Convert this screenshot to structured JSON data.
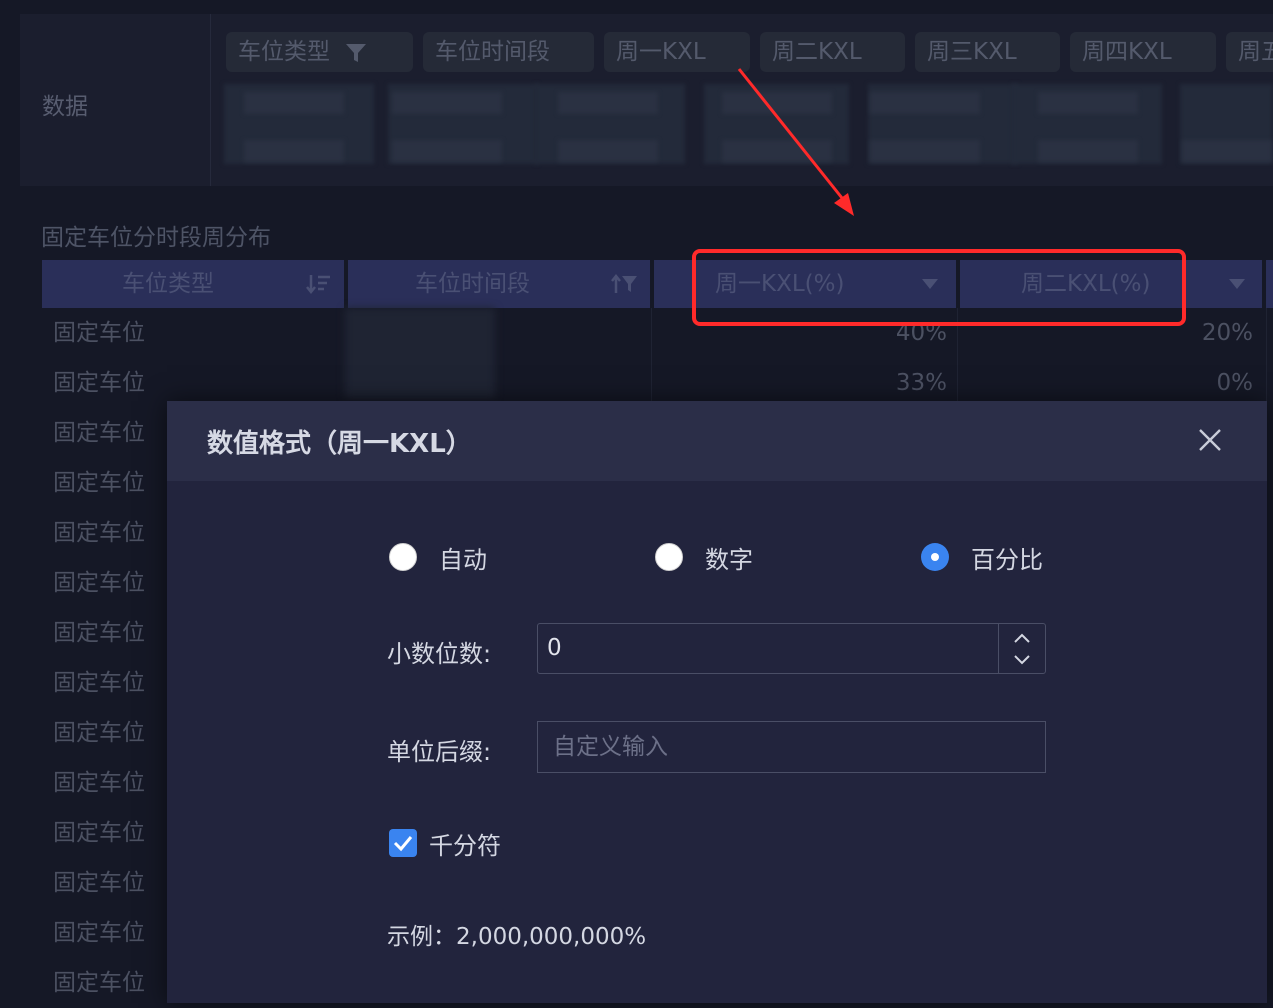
{
  "data_panel": {
    "label": "数据",
    "chips": [
      "车位类型",
      "车位时间段",
      "周一KXL",
      "周二KXL",
      "周三KXL",
      "周四KXL",
      "周五"
    ]
  },
  "report": {
    "title": "固定车位分时段周分布",
    "headers": [
      "车位类型",
      "车位时间段",
      "周一KXL(%)",
      "周二KXL(%)"
    ],
    "rows": [
      {
        "type": "固定车位",
        "mon": "40%",
        "tue": "20%"
      },
      {
        "type": "固定车位",
        "mon": "33%",
        "tue": "0%"
      },
      {
        "type": "固定车位"
      },
      {
        "type": "固定车位"
      },
      {
        "type": "固定车位"
      },
      {
        "type": "固定车位"
      },
      {
        "type": "固定车位"
      },
      {
        "type": "固定车位"
      },
      {
        "type": "固定车位"
      },
      {
        "type": "固定车位"
      },
      {
        "type": "固定车位"
      },
      {
        "type": "固定车位"
      },
      {
        "type": "固定车位"
      },
      {
        "type": "固定车位"
      }
    ]
  },
  "modal": {
    "title": "数值格式（周一KXL）",
    "options": [
      {
        "label": "自动",
        "checked": false
      },
      {
        "label": "数字",
        "checked": false
      },
      {
        "label": "百分比",
        "checked": true
      }
    ],
    "decimal_label": "小数位数:",
    "decimal_value": "0",
    "suffix_label": "单位后缀:",
    "suffix_placeholder": "自定义输入",
    "thousands_label": "千分符",
    "thousands_checked": true,
    "example": "示例：2,000,000,000%"
  },
  "colors": {
    "accent": "#3a84f0",
    "annotation": "#ff2a2a",
    "header_bg": "#2a2f59",
    "modal_bg": "#22243d"
  }
}
